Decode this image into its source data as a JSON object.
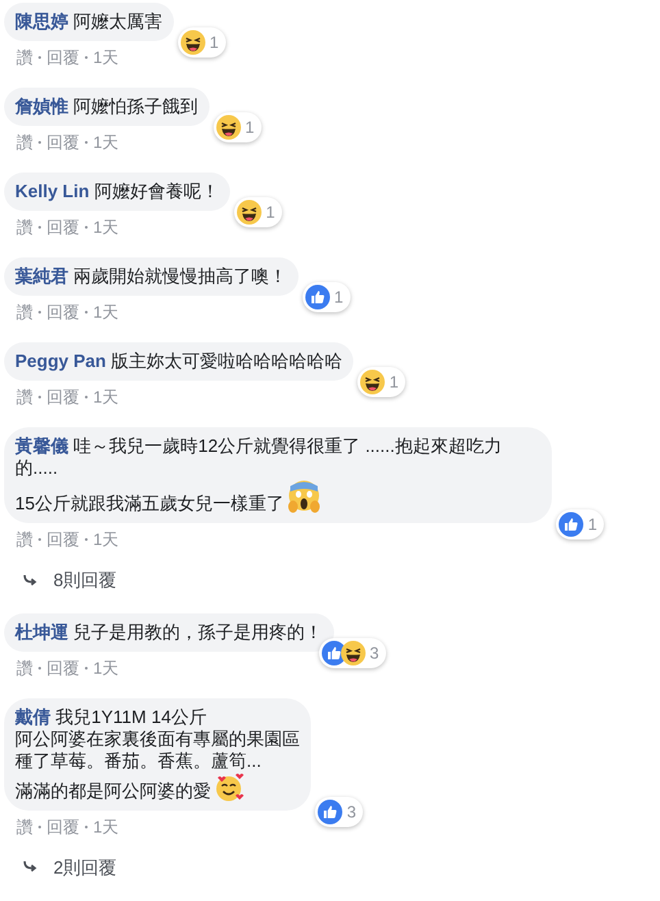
{
  "comments": [
    {
      "author": "陳思婷",
      "lines": [
        "阿嬤太厲害"
      ],
      "reactions": [
        {
          "kind": "haha"
        }
      ],
      "reaction_count": "1",
      "actions": [
        "讚",
        "回覆",
        "1天"
      ]
    },
    {
      "author": "詹媜惟",
      "lines": [
        "阿嬤怕孫子餓到"
      ],
      "reactions": [
        {
          "kind": "haha"
        }
      ],
      "reaction_count": "1",
      "actions": [
        "讚",
        "回覆",
        "1天"
      ]
    },
    {
      "author": "Kelly Lin",
      "lines": [
        "阿嬤好會養呢！"
      ],
      "reactions": [
        {
          "kind": "haha"
        }
      ],
      "reaction_count": "1",
      "actions": [
        "讚",
        "回覆",
        "1天"
      ]
    },
    {
      "author": "葉純君",
      "lines": [
        "兩歲開始就慢慢抽高了噢！"
      ],
      "reactions": [
        {
          "kind": "like"
        }
      ],
      "reaction_count": "1",
      "actions": [
        "讚",
        "回覆",
        "1天"
      ]
    },
    {
      "author": "Peggy Pan",
      "lines": [
        "版主妳太可愛啦哈哈哈哈哈哈"
      ],
      "reactions": [
        {
          "kind": "haha"
        }
      ],
      "reaction_count": "1",
      "actions": [
        "讚",
        "回覆",
        "1天"
      ]
    },
    {
      "author": "黃馨儀",
      "lines": [
        "哇～我兒一歲時12公斤就覺得很重了 ......抱起來超吃力的.....",
        "15公斤就跟我滿五歲女兒一樣重了"
      ],
      "trailing_emoji": {
        "kind": "scream"
      },
      "reactions": [
        {
          "kind": "like"
        }
      ],
      "reaction_count": "1",
      "actions": [
        "讚",
        "回覆",
        "1天"
      ],
      "replies": "8則回覆"
    },
    {
      "author": "杜坤運",
      "lines": [
        "兒子是用教的，孫子是用疼的！"
      ],
      "reactions": [
        {
          "kind": "like"
        },
        {
          "kind": "haha"
        }
      ],
      "reaction_count": "3",
      "actions": [
        "讚",
        "回覆",
        "1天"
      ]
    },
    {
      "author": "戴倩",
      "lines": [
        "我兒1Y11M 14公斤",
        "阿公阿婆在家裏後面有專屬的果園區",
        "種了草莓。番茄。香蕉。蘆筍...",
        "滿滿的都是阿公阿婆的愛"
      ],
      "trailing_emoji": {
        "kind": "hearts"
      },
      "reactions": [
        {
          "kind": "like"
        }
      ],
      "reaction_count": "3",
      "actions": [
        "讚",
        "回覆",
        "1天"
      ],
      "replies": "2則回覆"
    }
  ]
}
